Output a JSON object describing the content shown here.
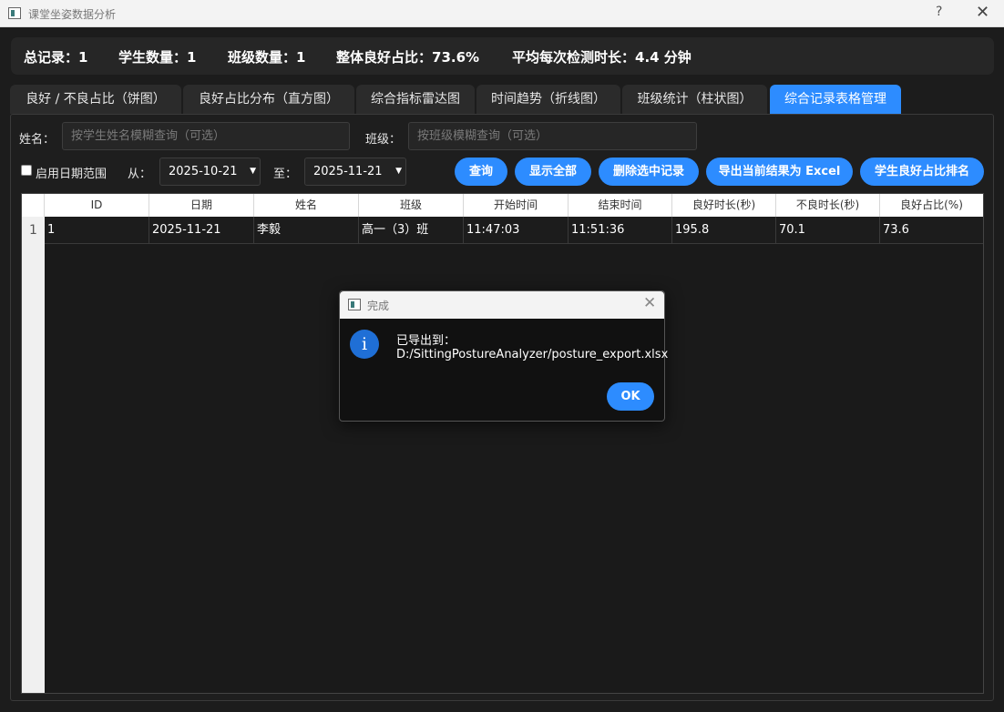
{
  "window": {
    "title": "课堂坐姿数据分析",
    "help": "?",
    "close": "✕"
  },
  "stats": {
    "total_records": "总记录：1",
    "student_count": "学生数量：1",
    "class_count": "班级数量：1",
    "good_ratio": "整体良好占比：73.6%",
    "avg_duration": "平均每次检测时长：4.4 分钟"
  },
  "tabs": [
    {
      "label": "良好 / 不良占比（饼图）"
    },
    {
      "label": "良好占比分布（直方图）"
    },
    {
      "label": "综合指标雷达图"
    },
    {
      "label": "时间趋势（折线图）"
    },
    {
      "label": "班级统计（柱状图）"
    },
    {
      "label": "综合记录表格管理"
    }
  ],
  "active_tab": 5,
  "filters": {
    "name_label": "姓名：",
    "name_placeholder": "按学生姓名模糊查询（可选）",
    "class_label": "班级：",
    "class_placeholder": "按班级模糊查询（可选）",
    "date_range_label": "启用日期范围",
    "from_label": "从：",
    "from_date": "2025-10-21",
    "to_label": "至：",
    "to_date": "2025-11-21"
  },
  "buttons": {
    "query": "查询",
    "show_all": "显示全部",
    "delete_selected": "删除选中记录",
    "export_excel": "导出当前结果为 Excel",
    "ranking": "学生良好占比排名"
  },
  "table": {
    "columns": [
      "ID",
      "日期",
      "姓名",
      "班级",
      "开始时间",
      "结束时间",
      "良好时长(秒)",
      "不良时长(秒)",
      "良好占比(%)"
    ],
    "rows": [
      {
        "row_number": "1",
        "cells": [
          "1",
          "2025-11-21",
          "李毅",
          "高一（3）班",
          "11:47:03",
          "11:51:36",
          "195.8",
          "70.1",
          "73.6"
        ]
      }
    ]
  },
  "dialog": {
    "title": "完成",
    "message_line1": "已导出到：",
    "message_line2": "D:/SittingPostureAnalyzer/posture_export.xlsx",
    "ok": "OK"
  },
  "colors": {
    "accent": "#2d8cff",
    "background": "#1c1c1c",
    "info_icon": "#1f6fd6"
  }
}
